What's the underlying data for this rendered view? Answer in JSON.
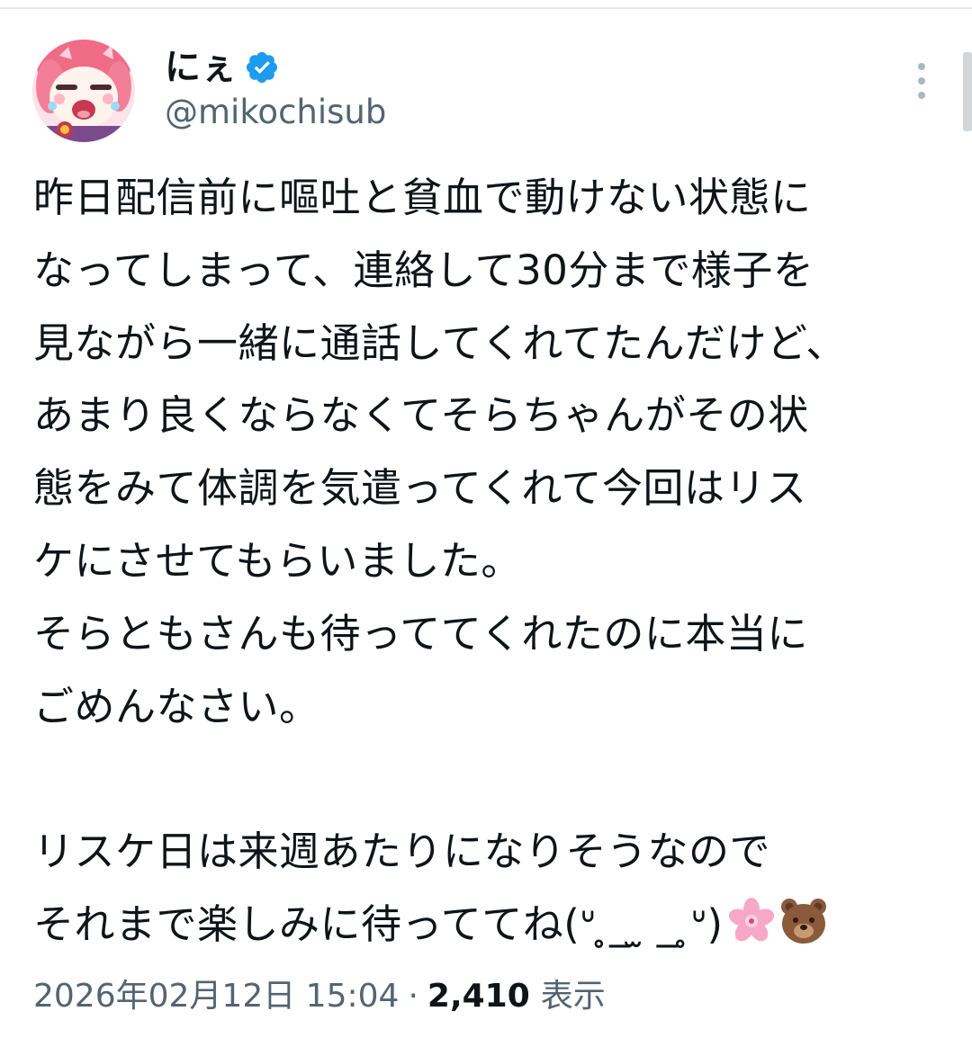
{
  "post": {
    "author": {
      "display_name": "にぇ",
      "handle": "@mikochisub",
      "verified": true
    },
    "body_lines": [
      "昨日配信前に嘔吐と貧血で動けない状態に",
      "なってしまって、連絡して30分まで様子を",
      "見ながら一緒に通話してくれてたんだけど、",
      "あまり良くならなくてそらちゃんがその状",
      "態をみて体調を気遣ってくれて今回はリス",
      "ケにさせてもらいました。",
      "そらともさんも待っててくれたのに本当に",
      "ごめんなさい。",
      "",
      "リスケ日は来週あたりになりそうなので",
      "それまで楽しみに待っててね(ᐡ ̥_ ̫ _ ̥ᐡ)"
    ],
    "trailing_emoji": [
      "cherry-blossom-emoji",
      "bear-face-emoji"
    ],
    "timestamp": "2026年02月12日 15:04",
    "separator": "·",
    "views_count": "2,410",
    "views_label": "表示"
  },
  "colors": {
    "text_primary": "#0f1419",
    "text_secondary": "#536471",
    "verified_blue": "#1d9bf0",
    "divider": "#e6e9ec"
  }
}
